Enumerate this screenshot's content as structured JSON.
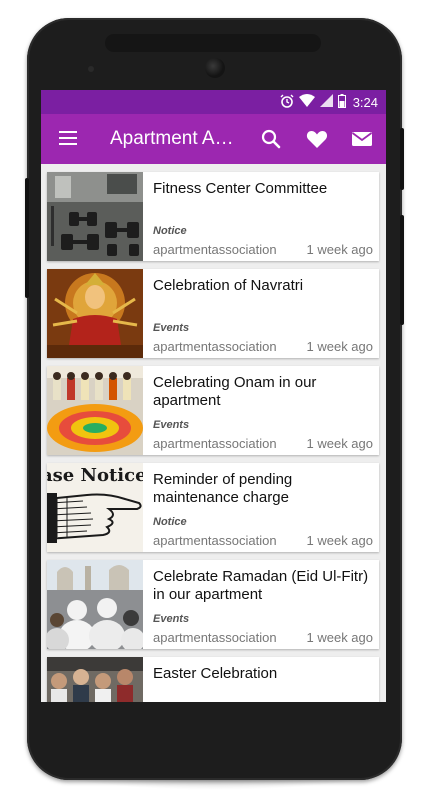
{
  "status_bar": {
    "time": "3:24",
    "icons": [
      "alarm-icon",
      "wifi-icon",
      "signal-icon",
      "battery-icon"
    ]
  },
  "toolbar": {
    "title": "Apartment Association",
    "actions": [
      "search-icon",
      "heart-icon",
      "mail-icon"
    ]
  },
  "colors": {
    "status_bar": "#7b1fa2",
    "toolbar": "#9c27b0",
    "background": "#eeeeee"
  },
  "posts": [
    {
      "title": "Fitness Center Committee",
      "category": "Notice",
      "author": "apartmentassociation",
      "time": "1 week ago",
      "thumbnail": "gym-equipment-image"
    },
    {
      "title": "Celebration of  Navratri",
      "category": "Events",
      "author": "apartmentassociation",
      "time": "1 week ago",
      "thumbnail": "navratri-idol-image"
    },
    {
      "title": "Celebrating Onam in our apartment",
      "category": "Events",
      "author": "apartmentassociation",
      "time": "1 week ago",
      "thumbnail": "onam-flower-carpet-image"
    },
    {
      "title": "Reminder of pending maintenance charge",
      "category": "Notice",
      "author": "apartmentassociation",
      "time": "1 week ago",
      "thumbnail": "notice-pointing-hand-image",
      "thumbnail_text": "ase Notice T"
    },
    {
      "title": "Celebrate Ramadan (Eid Ul-Fitr) in our apartment",
      "category": "Events",
      "author": "apartmentassociation",
      "time": "1 week ago",
      "thumbnail": "eid-prayer-image"
    },
    {
      "title": "Easter Celebration",
      "category": "",
      "author": "",
      "time": "",
      "thumbnail": "easter-crowd-image"
    }
  ]
}
